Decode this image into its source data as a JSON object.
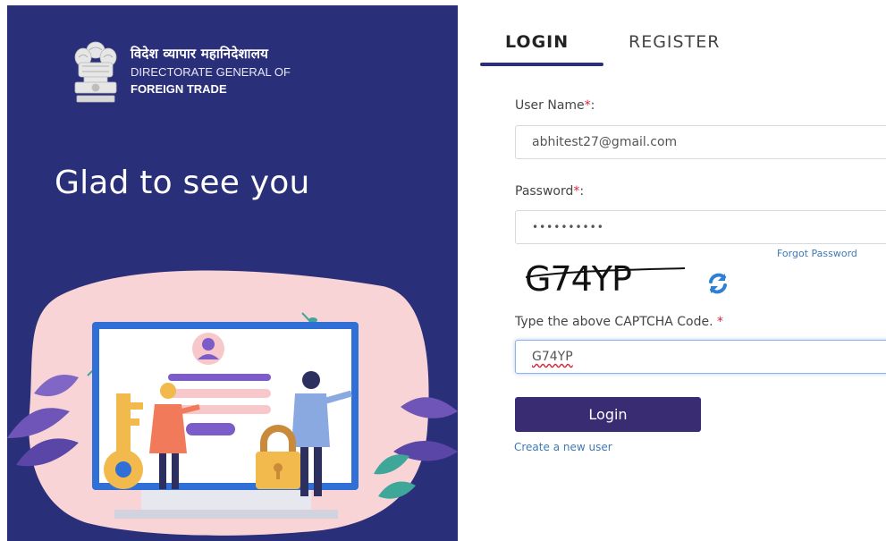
{
  "branding": {
    "org_hindi": "विदेश व्यापार महानिदेशालय",
    "org_line1": "DIRECTORATE GENERAL OF",
    "org_line2": "FOREIGN TRADE",
    "emblem_icon": "national-emblem-icon",
    "tagline": "Glad to see you",
    "panel_color": "#2a2f79"
  },
  "tabs": [
    {
      "label": "LOGIN",
      "active": true
    },
    {
      "label": "REGISTER",
      "active": false
    }
  ],
  "form": {
    "username": {
      "label": "User Name",
      "required_mark": "*",
      "suffix": ":",
      "value": "abhitest27@gmail.com"
    },
    "password": {
      "label": "Password",
      "required_mark": "*",
      "suffix": ":",
      "value": "••••••••••"
    },
    "forgot_password": "Forgot Password",
    "captcha": {
      "image_text": "G74YP",
      "refresh_icon": "refresh-icon"
    },
    "captcha_input": {
      "label": "Type the above CAPTCHA Code.",
      "required_mark": "*",
      "value": "G74YP"
    },
    "login_button": "Login",
    "create_user_link": "Create a new user"
  },
  "colors": {
    "accent": "#3a2c72",
    "link": "#3d7ab8",
    "required": "#d9233b"
  }
}
